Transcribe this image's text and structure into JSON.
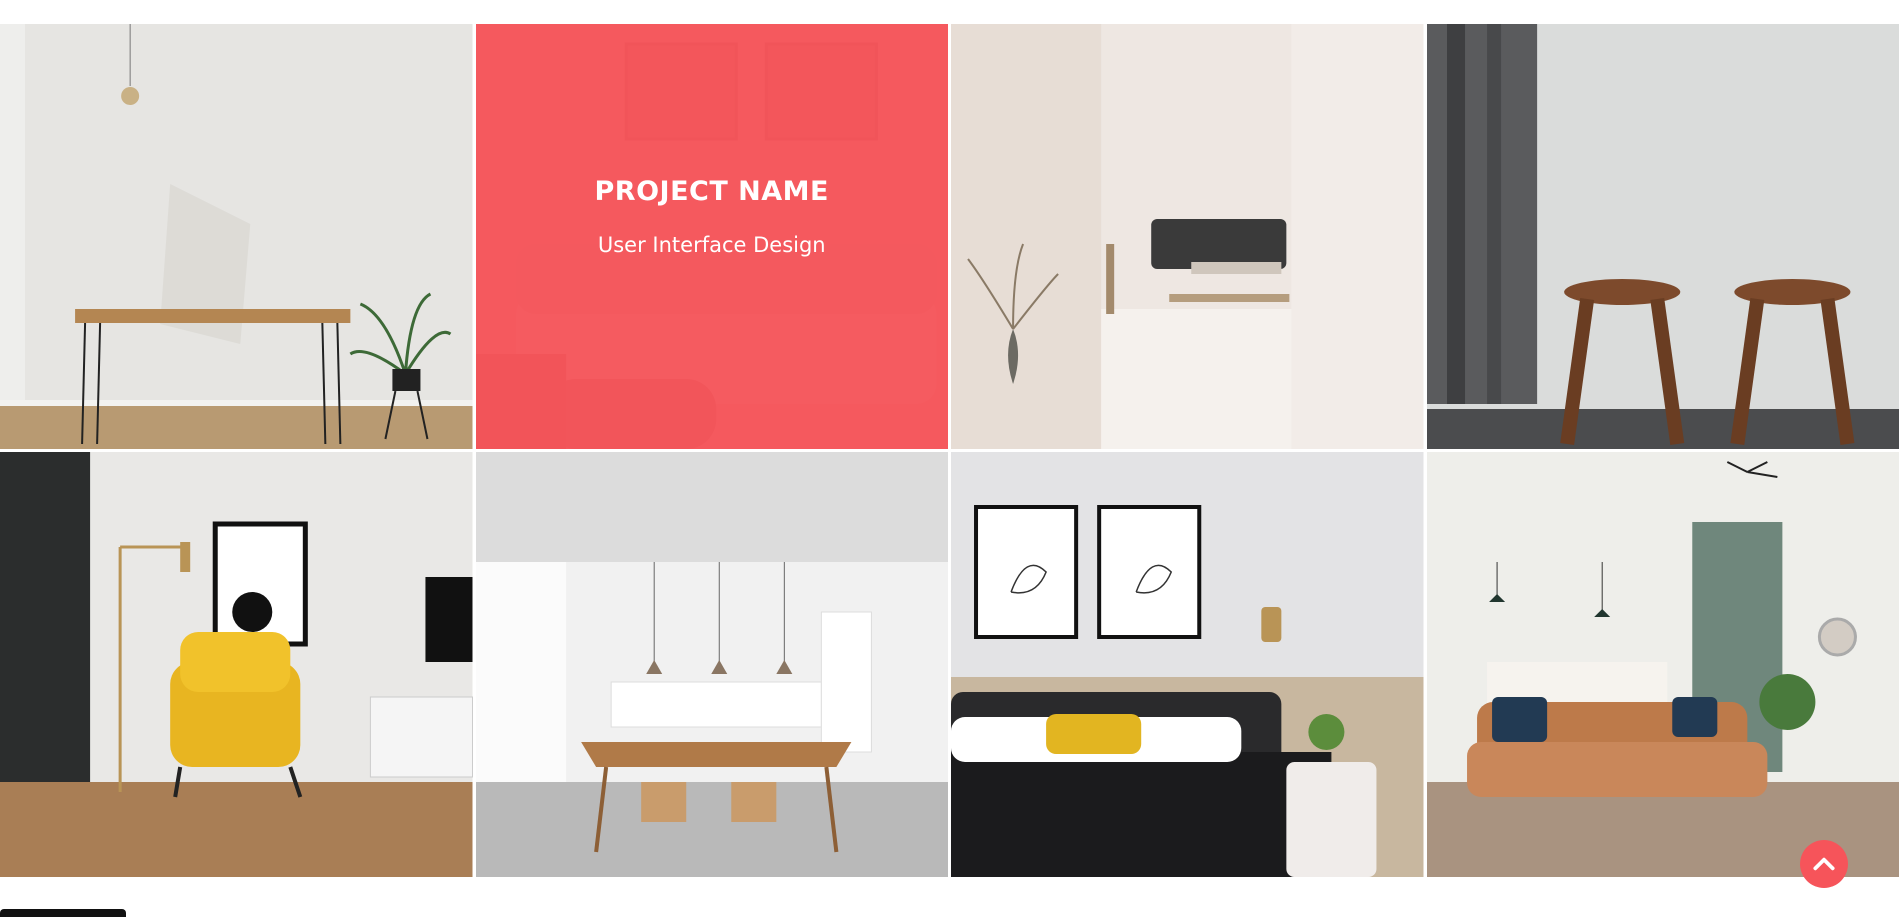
{
  "theme": {
    "accent": "#f6545a"
  },
  "portfolio": {
    "items": [
      {
        "scene": "console-table-with-plant"
      },
      {
        "scene": "red-sofa-living-room",
        "hovered": true,
        "title": "PROJECT NAME",
        "category": "User Interface Design"
      },
      {
        "scene": "minimal-room-dark-sofa"
      },
      {
        "scene": "two-wooden-stools"
      },
      {
        "scene": "yellow-armchair-corner"
      },
      {
        "scene": "white-kitchen-dining"
      },
      {
        "scene": "bedroom-line-art-frames"
      },
      {
        "scene": "leather-sofa-open-plan"
      }
    ]
  },
  "scroll_top": {
    "icon": "chevron-up-icon"
  }
}
